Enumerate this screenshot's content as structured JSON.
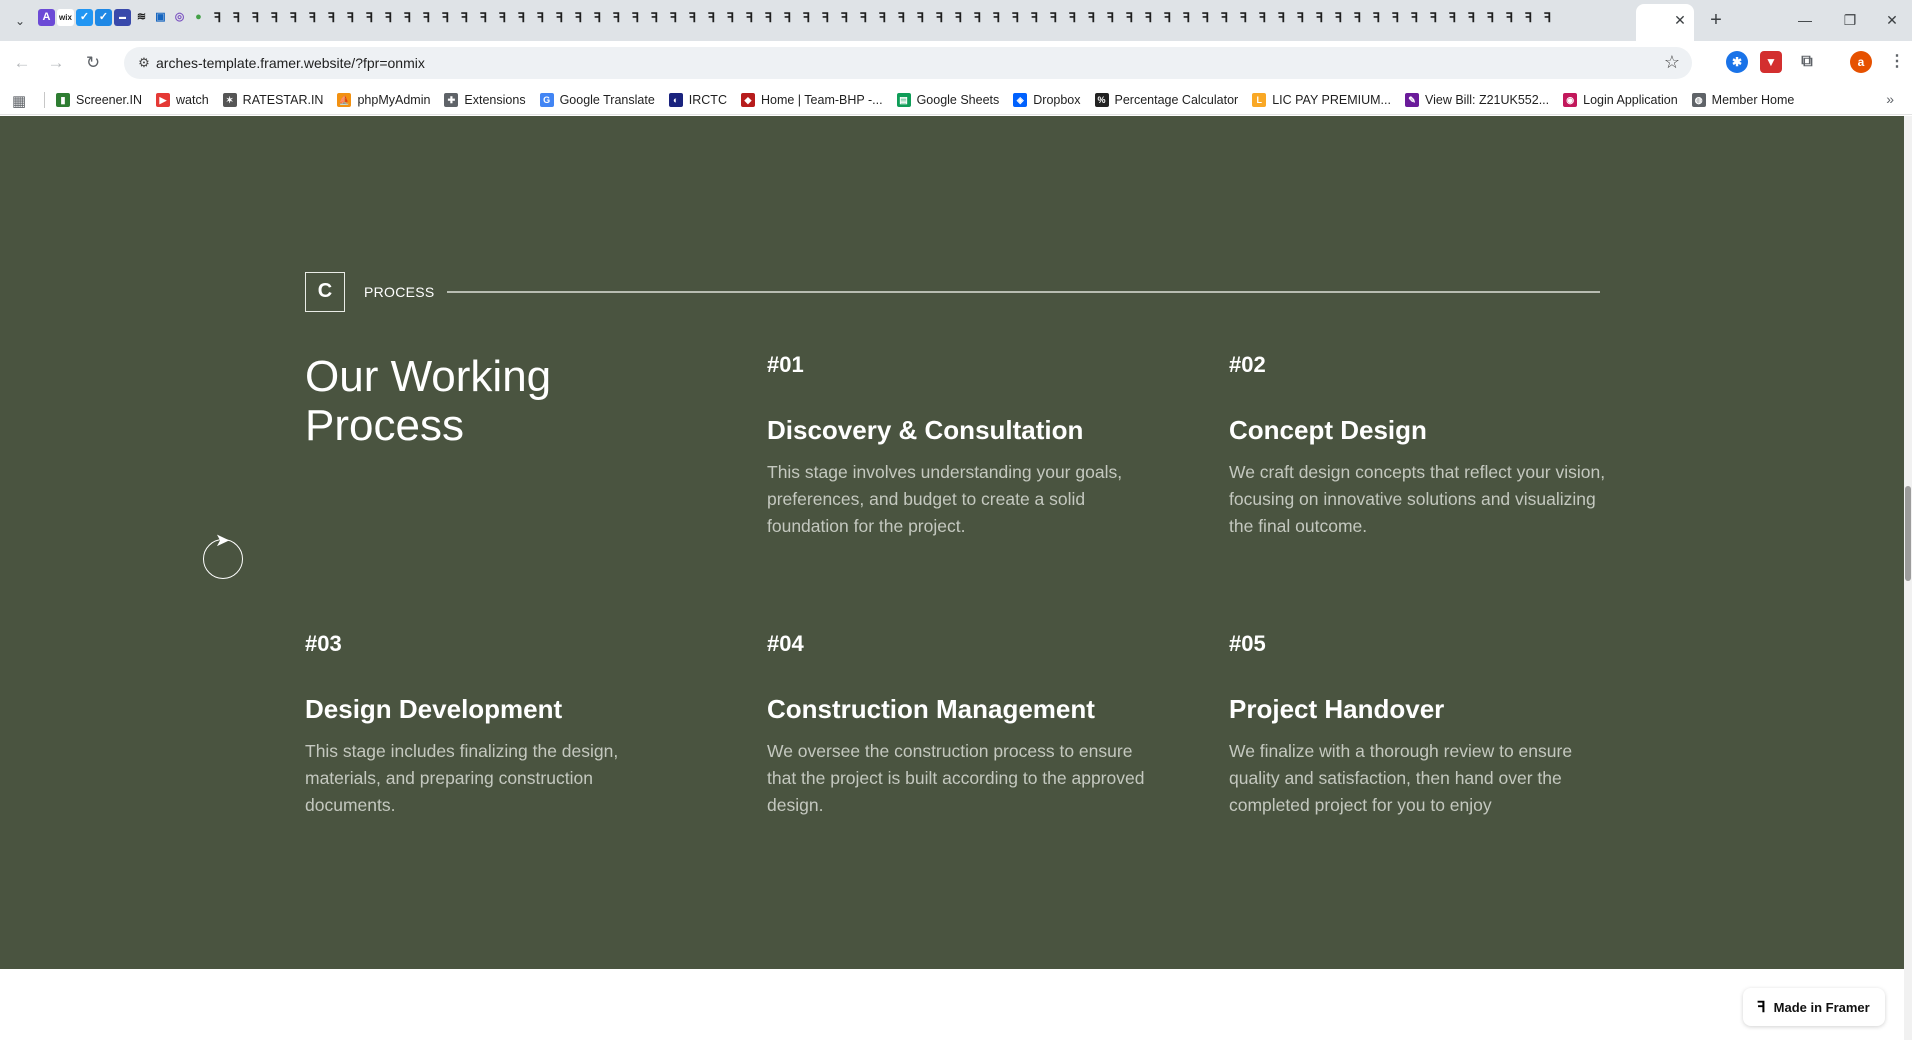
{
  "browser": {
    "tab_close": "✕",
    "new_tab": "+",
    "url": "arches-template.framer.website/?fpr=onmix",
    "profile_initial": "a",
    "window_controls": {
      "minimize": "—",
      "restore": "❐",
      "close": "✕"
    }
  },
  "bookmarks": [
    {
      "label": "Screener.IN",
      "icon": "bar-chart-icon",
      "color": "#2e7d32"
    },
    {
      "label": "watch",
      "icon": "youtube-icon",
      "color": "#e53935"
    },
    {
      "label": "RATESTAR.IN",
      "icon": "ratestar-icon",
      "color": "#555555"
    },
    {
      "label": "phpMyAdmin",
      "icon": "phpmyadmin-icon",
      "color": "#f29111"
    },
    {
      "label": "Extensions",
      "icon": "puzzle-icon",
      "color": "#5f6368"
    },
    {
      "label": "Google Translate",
      "icon": "translate-icon",
      "color": "#4285f4"
    },
    {
      "label": "IRCTC",
      "icon": "irctc-icon",
      "color": "#1a237e"
    },
    {
      "label": "Home | Team-BHP -...",
      "icon": "teambhp-icon",
      "color": "#b71c1c"
    },
    {
      "label": "Google Sheets",
      "icon": "sheets-icon",
      "color": "#0f9d58"
    },
    {
      "label": "Dropbox",
      "icon": "dropbox-icon",
      "color": "#0061fe"
    },
    {
      "label": "Percentage Calculator",
      "icon": "percent-icon",
      "color": "#222222"
    },
    {
      "label": "LIC PAY PREMIUM...",
      "icon": "lic-icon",
      "color": "#f9a825"
    },
    {
      "label": "View Bill: Z21UK552...",
      "icon": "bill-icon",
      "color": "#6a1b9a"
    },
    {
      "label": "Login Application",
      "icon": "login-icon",
      "color": "#c2185b"
    },
    {
      "label": "Member Home",
      "icon": "globe-icon",
      "color": "#5f6368"
    }
  ],
  "section": {
    "logo_letter": "C",
    "label": "PROCESS",
    "heading": "Our Working Process",
    "steps": [
      {
        "num": "#01",
        "title": "Discovery & Consultation",
        "desc": "This stage involves understanding your goals, preferences, and budget to create a solid foundation for the project."
      },
      {
        "num": "#02",
        "title": "Concept Design",
        "desc": "We craft design concepts that reflect your vision, focusing on innovative solutions and visualizing the final outcome."
      },
      {
        "num": "#03",
        "title": "Design Development",
        "desc": "This stage includes finalizing the design, materials, and preparing construction documents."
      },
      {
        "num": "#04",
        "title": "Construction Management",
        "desc": "We oversee the construction process to ensure that the project is built according to the approved design."
      },
      {
        "num": "#05",
        "title": "Project Handover",
        "desc": "We finalize with a thorough review to ensure quality and satisfaction, then hand over the completed project for you to enjoy"
      }
    ]
  },
  "badge": {
    "label": "Made in Framer"
  },
  "colors": {
    "section_bg": "#4a5440",
    "desc_text": "#c4c8bf"
  }
}
